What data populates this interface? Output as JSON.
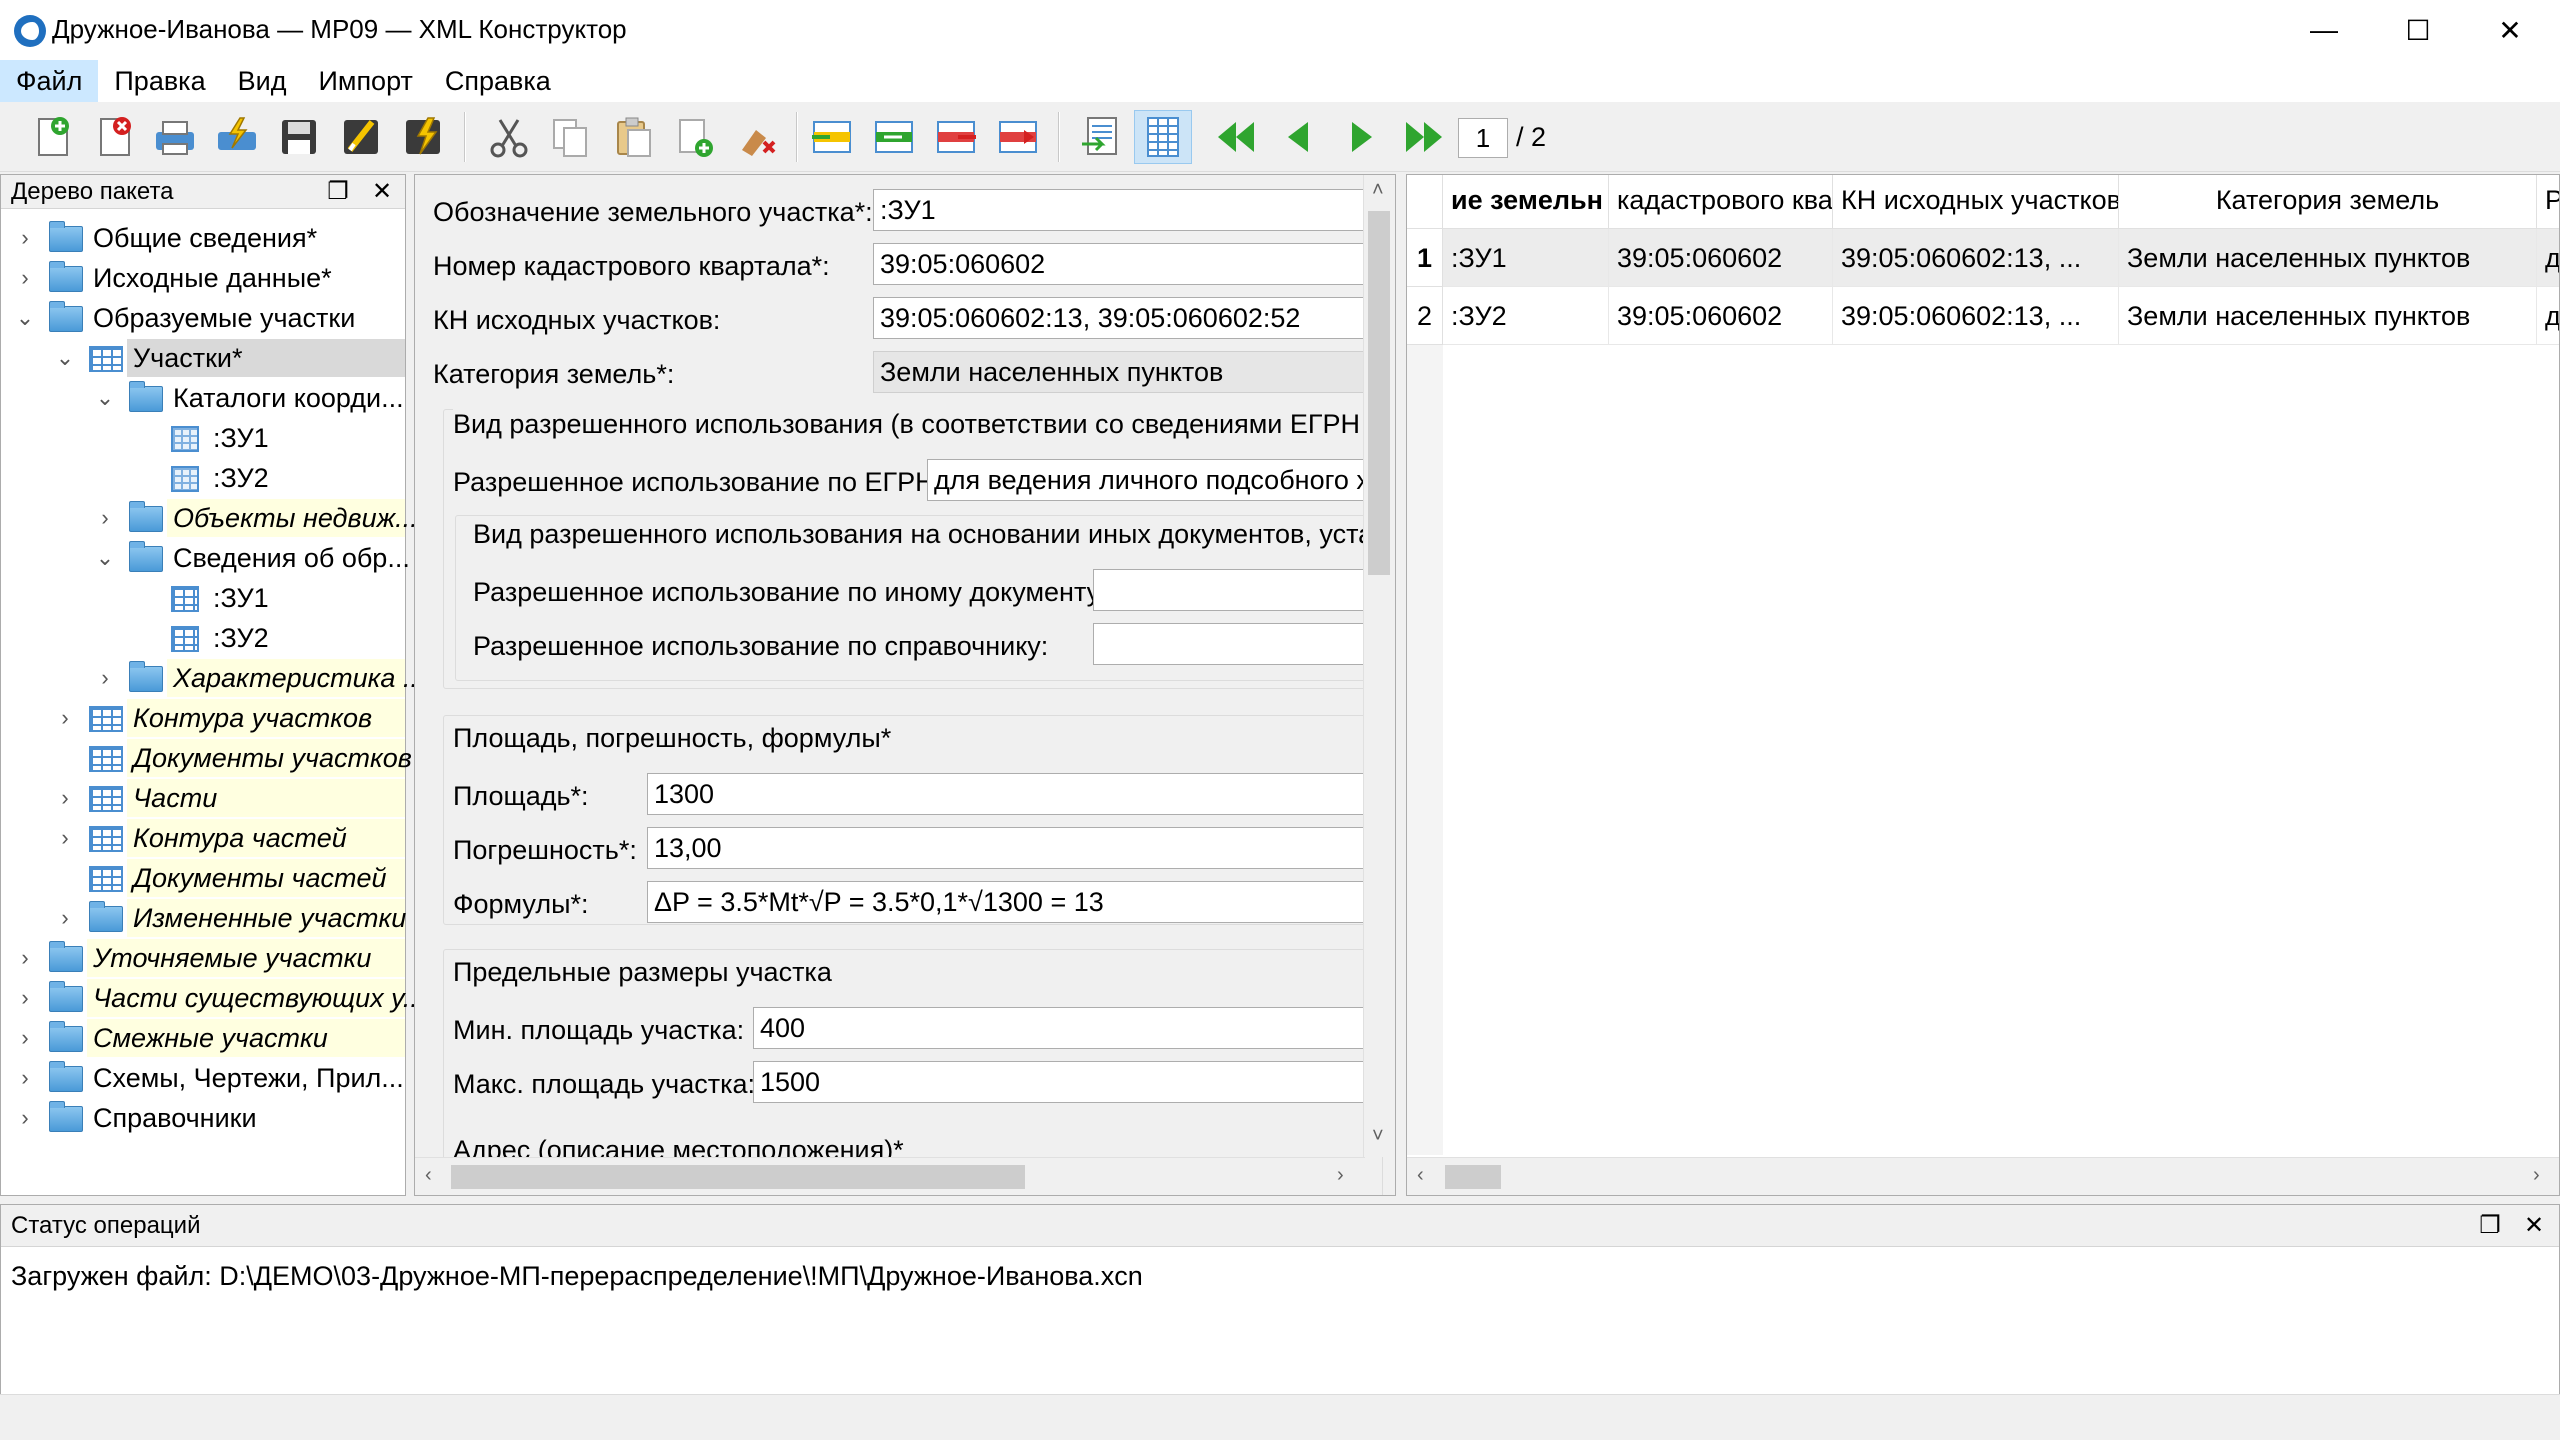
{
  "window": {
    "title": "Дружное-Иванова — МР09 — XML Конструктор",
    "minimize": "—",
    "maximize": "☐",
    "close": "✕"
  },
  "menu": [
    "Файл",
    "Правка",
    "Вид",
    "Импорт",
    "Справка"
  ],
  "toolbar": {
    "icons": [
      "new-document-icon",
      "delete-document-icon",
      "print-icon",
      "export-icon",
      "save-icon",
      "validate-icon",
      "sign-icon",
      "cut-icon",
      "copy-icon",
      "paste-icon",
      "paste-special-icon",
      "clear-icon",
      "insert-row-icon",
      "insert-column-icon",
      "delete-row-icon",
      "move-row-icon",
      "form-view-icon",
      "table-view-icon",
      "first-record-icon",
      "previous-record-icon",
      "next-record-icon",
      "last-record-icon"
    ],
    "page_current": "1",
    "page_total": "/ 2"
  },
  "tree": {
    "title": "Дерево пакета",
    "float_icon": "❐",
    "close_icon": "✕",
    "items": [
      {
        "label": "Общие сведения*"
      },
      {
        "label": "Исходные данные*"
      },
      {
        "label": "Образуемые участки"
      },
      {
        "label": "Участки*"
      },
      {
        "label": "Каталоги коорди..."
      },
      {
        "label": ":ЗУ1"
      },
      {
        "label": ":ЗУ2"
      },
      {
        "label": "Объекты недвиж..."
      },
      {
        "label": "Сведения об обр..."
      },
      {
        "label": ":ЗУ1"
      },
      {
        "label": ":ЗУ2"
      },
      {
        "label": "Характеристика ..."
      },
      {
        "label": "Контура участков"
      },
      {
        "label": "Документы участков"
      },
      {
        "label": "Части"
      },
      {
        "label": "Контура частей"
      },
      {
        "label": "Документы частей"
      },
      {
        "label": "Измененные участки"
      },
      {
        "label": "Уточняемые участки"
      },
      {
        "label": "Части существующих у..."
      },
      {
        "label": "Смежные участки"
      },
      {
        "label": "Схемы, Чертежи, Прил..."
      },
      {
        "label": "Справочники"
      }
    ]
  },
  "form": {
    "designation_label": "Обозначение земельного участка*:",
    "designation_value": ":ЗУ1",
    "quarter_label": "Номер кадастрового квартала*:",
    "quarter_value": "39:05:060602",
    "source_kn_label": "КН исходных участков:",
    "source_kn_value": "39:05:060602:13, 39:05:060602:52",
    "category_label": "Категория земель*:",
    "category_value": "Земли населенных пунктов",
    "permitted_use_group": "Вид разрешенного использования (в соответствии со сведениями ЕГРН или",
    "egrn_use_label": "Разрешенное использование по ЕГРН:",
    "egrn_use_value": "для ведения личного подсобного хо",
    "other_docs_group": "Вид разрешенного использования на основании иных документов, устано",
    "other_doc_label": "Разрешенное использование по иному документу:",
    "other_doc_value": "",
    "reference_label": "Разрешенное использование по справочнику:",
    "reference_value": "",
    "area_group": "Площадь, погрешность, формулы*",
    "area_label": "Площадь*:",
    "area_value": "1300",
    "error_label": "Погрешность*:",
    "error_value": "13,00",
    "formula_label": "Формулы*:",
    "formula_value": "ΔP = 3.5*Mt*√P = 3.5*0,1*√1300 = 13",
    "limits_group": "Предельные размеры участка",
    "min_area_label": "Мин. площадь участка:",
    "min_area_value": "400",
    "max_area_label": "Макс. площадь участка:",
    "max_area_value": "1500",
    "address_group": "Адрес (описание местоположения)*"
  },
  "table": {
    "columns": [
      "ие земельн",
      "кадастрового ква",
      "КН исходных участков",
      "Категория земель",
      "Р"
    ],
    "rows": [
      {
        "num": "1",
        "cells": [
          ":ЗУ1",
          "39:05:060602",
          "39:05:060602:13, ...",
          "Земли населенных пунктов",
          "д"
        ]
      },
      {
        "num": "2",
        "cells": [
          ":ЗУ2",
          "39:05:060602",
          "39:05:060602:13, ...",
          "Земли населенных пунктов",
          "д"
        ]
      }
    ]
  },
  "status": {
    "title": "Статус операций",
    "message": "Загружен файл: D:\\ДЕМО\\03-Дружное-МП-перераспределение\\!МП\\Дружное-Иванова.xcn"
  }
}
